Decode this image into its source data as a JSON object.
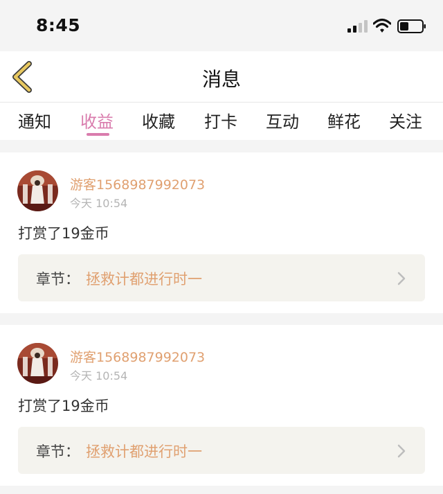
{
  "status": {
    "time": "8:45"
  },
  "nav": {
    "title": "消息"
  },
  "tabs": [
    {
      "label": "通知"
    },
    {
      "label": "收益"
    },
    {
      "label": "收藏"
    },
    {
      "label": "打卡"
    },
    {
      "label": "互动"
    },
    {
      "label": "鲜花"
    },
    {
      "label": "关注"
    }
  ],
  "active_tab": "收益",
  "cards": [
    {
      "username": "游客1568987992073",
      "time": "今天 10:54",
      "message": "打赏了19金币",
      "chapter_label": "章节：",
      "chapter_title": "拯救计都进行时一"
    },
    {
      "username": "游客1568987992073",
      "time": "今天 10:54",
      "message": "打赏了19金币",
      "chapter_label": "章节：",
      "chapter_title": "拯救计都进行时一"
    }
  ],
  "colors": {
    "accent_pink": "#d97cad",
    "username_orange": "#e0a070",
    "back_arrow": "#e8c860"
  },
  "icons": [
    "signal-icon",
    "wifi-icon",
    "battery-icon",
    "back-arrow-icon",
    "chevron-right-icon"
  ]
}
